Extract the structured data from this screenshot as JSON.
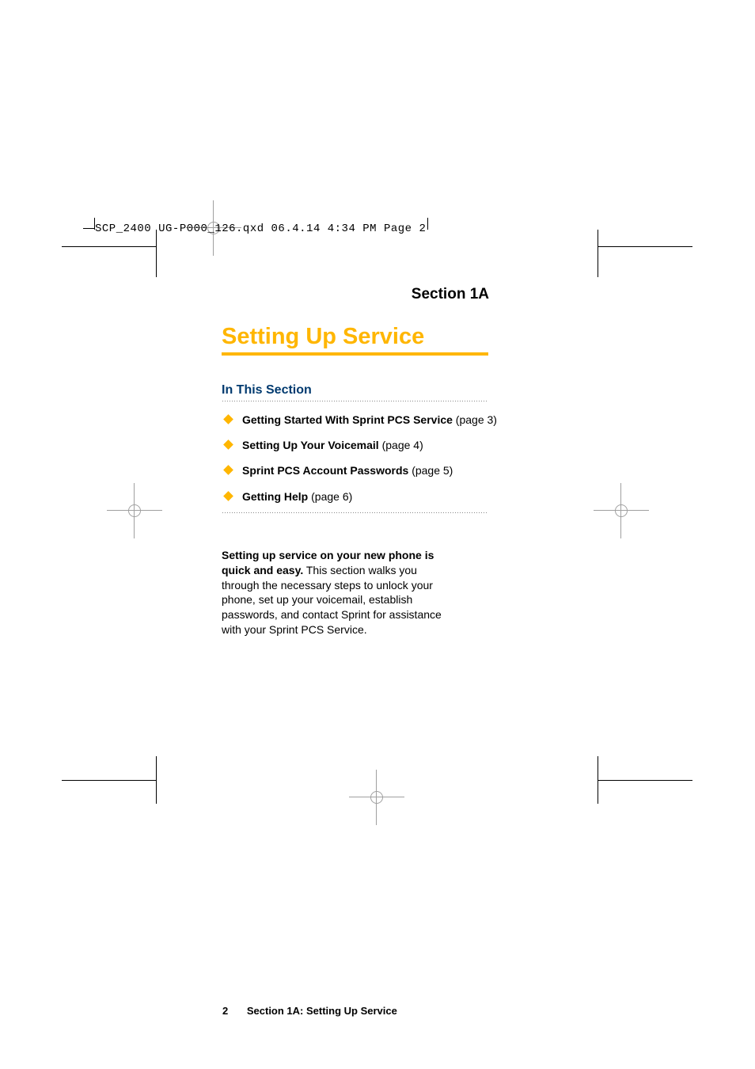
{
  "header_line": "SCP_2400 UG-P000_126.qxd  06.4.14  4:34 PM  Page 2",
  "section_label": "Section 1A",
  "main_title": "Setting Up Service",
  "in_this_section": "In This Section",
  "toc": [
    {
      "label": "Getting Started With Sprint PCS Service",
      "ref": " (page 3)"
    },
    {
      "label": "Setting Up Your Voicemail",
      "ref": " (page 4)"
    },
    {
      "label": "Sprint PCS Account Passwords",
      "ref": " (page 5)"
    },
    {
      "label": "Getting Help",
      "ref": " (page 6)"
    }
  ],
  "body_lead": "Setting up service on your new phone is quick and easy.",
  "body_rest": " This section walks you through the necessary steps to unlock your phone, set up your voicemail, establish passwords, and contact Sprint for assistance with your Sprint PCS Service.",
  "footer": {
    "page_num": "2",
    "text": "Section 1A: Setting Up Service"
  }
}
